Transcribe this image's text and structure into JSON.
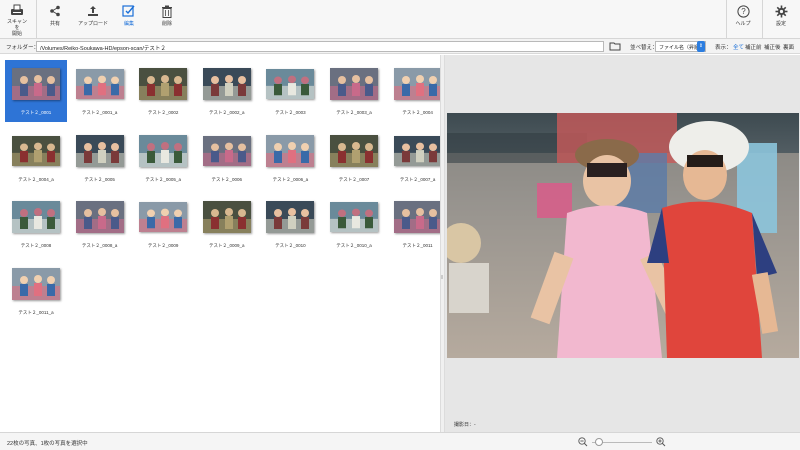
{
  "toolbar": {
    "scan": "スキャンを\n開始",
    "share": "共有",
    "upload": "アップロード",
    "edit": "編集",
    "delete": "削除",
    "help": "ヘルプ",
    "settings": "設定"
  },
  "folderbar": {
    "label": "フォルダー：",
    "path": "/Volumes/Reiko-Soukawa-HD/epson-scan/テスト２",
    "sort_label": "並べ替え：",
    "sort_value": "ファイル名（昇順）",
    "show_label": "表示：",
    "show_options": [
      "全て",
      "補正前",
      "補正後",
      "裏面"
    ]
  },
  "thumbnails": [
    {
      "name": "テスト２_0001",
      "selected": true
    },
    {
      "name": "テスト２_0001_a"
    },
    {
      "name": "テスト２_0002"
    },
    {
      "name": "テスト２_0002_a"
    },
    {
      "name": "テスト２_0003"
    },
    {
      "name": "テスト２_0003_a"
    },
    {
      "name": "テスト２_0004"
    },
    {
      "name": "テスト２_0004_a"
    },
    {
      "name": "テスト２_0005"
    },
    {
      "name": "テスト２_0005_a"
    },
    {
      "name": "テスト２_0006"
    },
    {
      "name": "テスト２_0006_a"
    },
    {
      "name": "テスト２_0007"
    },
    {
      "name": "テスト２_0007_a"
    },
    {
      "name": "テスト２_0008"
    },
    {
      "name": "テスト２_0008_a"
    },
    {
      "name": "テスト２_0009"
    },
    {
      "name": "テスト２_0009_a"
    },
    {
      "name": "テスト２_0010"
    },
    {
      "name": "テスト２_0010_a"
    },
    {
      "name": "テスト２_0011"
    },
    {
      "name": "テスト２_0011_a"
    }
  ],
  "preview": {
    "shot_date_label": "撮影日：-"
  },
  "status": {
    "text": "22枚の写真、1枚の写真を選択中",
    "zoom_level": 0.05
  },
  "colors": {
    "accent": "#2e74d6",
    "panel_bg": "#e6e6e6"
  }
}
